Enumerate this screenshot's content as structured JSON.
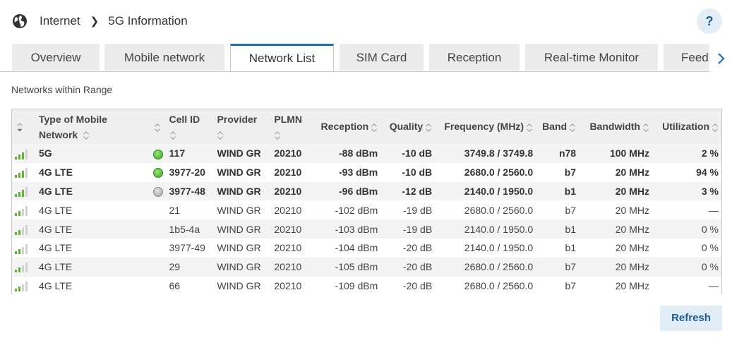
{
  "breadcrumb": {
    "root": "Internet",
    "current": "5G Information"
  },
  "help": {
    "label": "?"
  },
  "tabs": [
    {
      "label": "Overview",
      "active": false
    },
    {
      "label": "Mobile network",
      "active": false
    },
    {
      "label": "Network List",
      "active": true
    },
    {
      "label": "SIM Card",
      "active": false
    },
    {
      "label": "Reception",
      "active": false
    },
    {
      "label": "Real-time Monitor",
      "active": false
    },
    {
      "label": "Feedback",
      "active": false
    }
  ],
  "section_title": "Networks within Range",
  "table": {
    "headers": {
      "type_line1": "Type of Mobile",
      "type_line2": "Network",
      "cell_id": "Cell ID",
      "provider": "Provider",
      "plmn": "PLMN",
      "reception": "Reception",
      "quality": "Quality",
      "frequency": "Frequency (MHz)",
      "band": "Band",
      "bandwidth": "Bandwidth",
      "utilization": "Utilization"
    },
    "rows": [
      {
        "bold": true,
        "bars": 3,
        "type": "5G",
        "status": "green",
        "cell_id": "117",
        "provider": "WIND GR",
        "plmn": "20210",
        "reception": "-88 dBm",
        "quality": "-10 dB",
        "frequency": "3749.8 / 3749.8",
        "band": "n78",
        "bandwidth": "100 MHz",
        "utilization": "2 %"
      },
      {
        "bold": true,
        "bars": 3,
        "type": "4G LTE",
        "status": "green",
        "cell_id": "3977-20",
        "provider": "WIND GR",
        "plmn": "20210",
        "reception": "-93 dBm",
        "quality": "-10 dB",
        "frequency": "2680.0 / 2560.0",
        "band": "b7",
        "bandwidth": "20 MHz",
        "utilization": "94 %"
      },
      {
        "bold": true,
        "bars": 3,
        "type": "4G LTE",
        "status": "gray",
        "cell_id": "3977-48",
        "provider": "WIND GR",
        "plmn": "20210",
        "reception": "-96 dBm",
        "quality": "-12 dB",
        "frequency": "2140.0 / 1950.0",
        "band": "b1",
        "bandwidth": "20 MHz",
        "utilization": "3 %"
      },
      {
        "bold": false,
        "bars": 2,
        "type": "4G LTE",
        "status": "",
        "cell_id": "21",
        "provider": "WIND GR",
        "plmn": "20210",
        "reception": "-102 dBm",
        "quality": "-19 dB",
        "frequency": "2680.0 / 2560.0",
        "band": "b7",
        "bandwidth": "20 MHz",
        "utilization": "—"
      },
      {
        "bold": false,
        "bars": 2,
        "type": "4G LTE",
        "status": "",
        "cell_id": "1b5-4a",
        "provider": "WIND GR",
        "plmn": "20210",
        "reception": "-103 dBm",
        "quality": "-19 dB",
        "frequency": "2140.0 / 1950.0",
        "band": "b1",
        "bandwidth": "20 MHz",
        "utilization": "0 %"
      },
      {
        "bold": false,
        "bars": 2,
        "type": "4G LTE",
        "status": "",
        "cell_id": "3977-49",
        "provider": "WIND GR",
        "plmn": "20210",
        "reception": "-104 dBm",
        "quality": "-20 dB",
        "frequency": "2140.0 / 1950.0",
        "band": "b1",
        "bandwidth": "20 MHz",
        "utilization": "0 %"
      },
      {
        "bold": false,
        "bars": 2,
        "type": "4G LTE",
        "status": "",
        "cell_id": "29",
        "provider": "WIND GR",
        "plmn": "20210",
        "reception": "-105 dBm",
        "quality": "-20 dB",
        "frequency": "2680.0 / 2560.0",
        "band": "b7",
        "bandwidth": "20 MHz",
        "utilization": "0 %"
      },
      {
        "bold": false,
        "bars": 2,
        "type": "4G LTE",
        "status": "",
        "cell_id": "66",
        "provider": "WIND GR",
        "plmn": "20210",
        "reception": "-109 dBm",
        "quality": "-20 dB",
        "frequency": "2680.0 / 2560.0",
        "band": "b7",
        "bandwidth": "20 MHz",
        "utilization": "—"
      }
    ]
  },
  "refresh_label": "Refresh",
  "colors": {
    "accent": "#1f6fb2",
    "signal_on": "#5cb531",
    "signal_off": "#d2d2d2",
    "status_green": "#3caa24",
    "status_gray": "#a3a3a3"
  },
  "icons": {
    "breadcrumb": "globe-icon",
    "breadcrumb_separator": "chevron-right-icon",
    "tab_scroll": "chevron-right-icon",
    "row_signal": "signal-bars-icon",
    "status": "status-led-icon",
    "sort": "sort-icon"
  }
}
